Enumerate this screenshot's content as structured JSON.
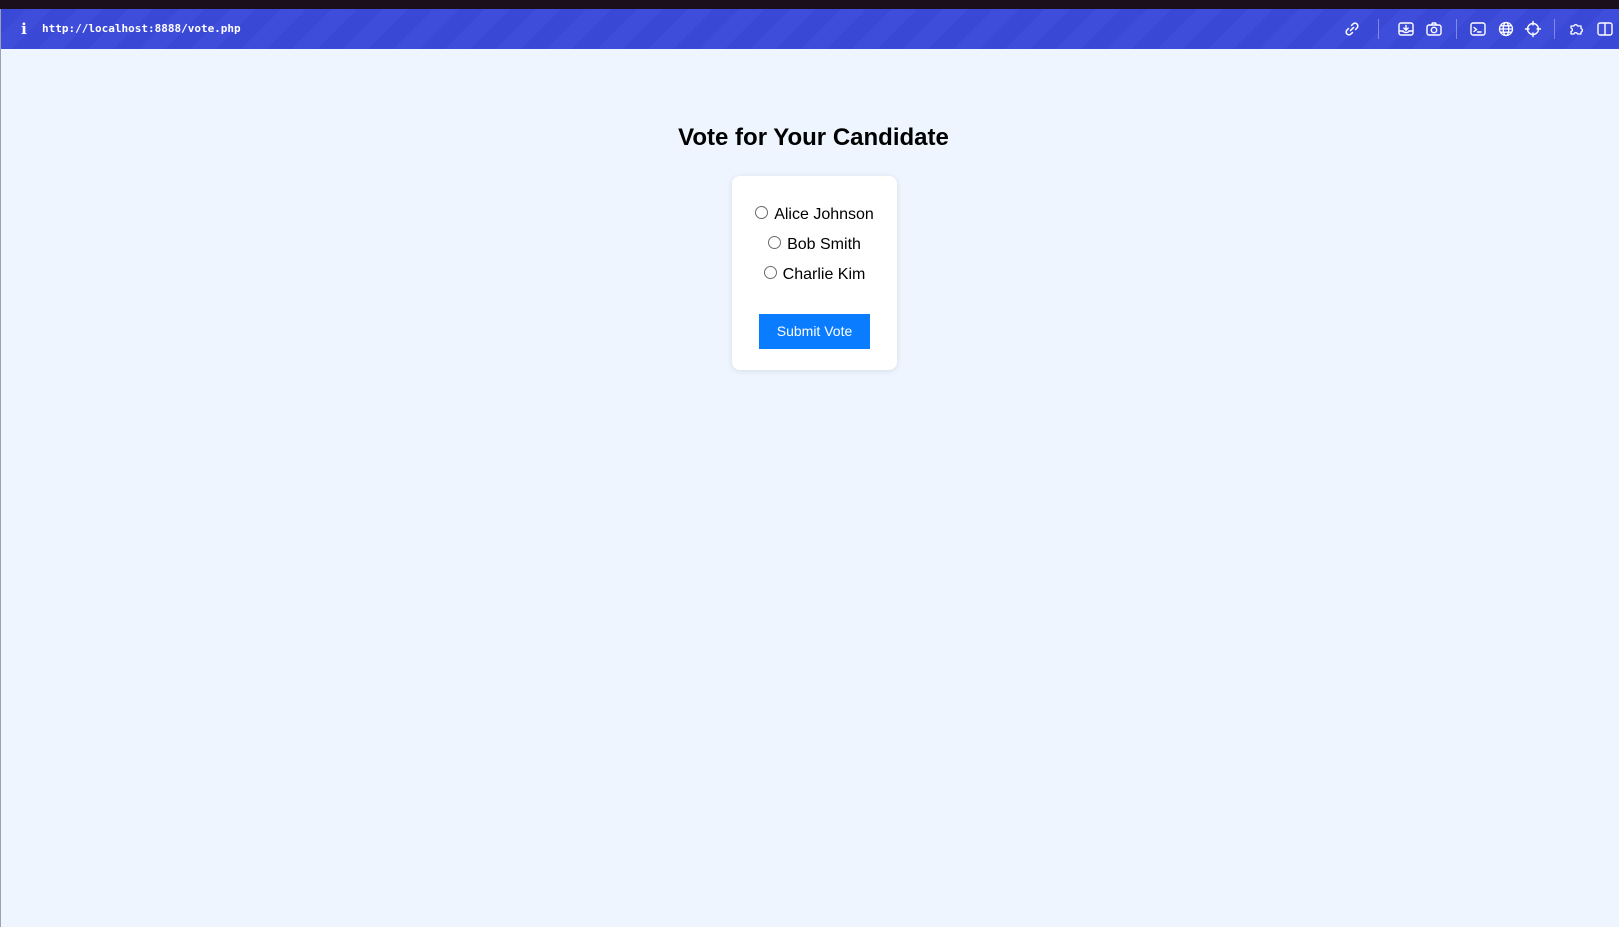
{
  "browser": {
    "url": "http://localhost:8888/vote.php",
    "info_icon": "i",
    "toolbar_icons": [
      "link-icon",
      "save-page-icon",
      "camera-icon",
      "terminal-icon",
      "globe-icon",
      "crosshair-icon",
      "extensions-icon",
      "sidebar-icon"
    ]
  },
  "page": {
    "title": "Vote for Your Candidate",
    "candidates": [
      {
        "label": "Alice Johnson",
        "selected": false
      },
      {
        "label": "Bob Smith",
        "selected": false
      },
      {
        "label": "Charlie Kim",
        "selected": false
      }
    ],
    "submit_label": "Submit Vote"
  },
  "colors": {
    "toolbar": "#3a48d6",
    "page_background": "#eef5ff",
    "button": "#0a7cff"
  }
}
